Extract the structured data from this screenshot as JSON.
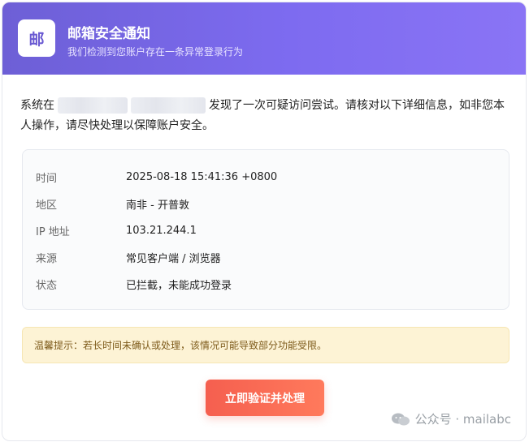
{
  "header": {
    "logo_char": "邮",
    "title": "邮箱安全通知",
    "subtitle": "我们检测到您账户存在一条异常登录行为"
  },
  "message": {
    "prefix": "系统在",
    "suffix": "发现了一次可疑访问尝试。请核对以下详细信息，如非您本人操作，请尽快处理以保障账户安全。"
  },
  "info": {
    "rows": [
      {
        "label": "时间",
        "value": "2025-08-18 15:41:36 +0800"
      },
      {
        "label": "地区",
        "value": "南非 - 开普敦"
      },
      {
        "label": "IP 地址",
        "value": "103.21.244.1"
      },
      {
        "label": "来源",
        "value": "常见客户端 / 浏览器"
      },
      {
        "label": "状态",
        "value": "已拦截，未能成功登录"
      }
    ]
  },
  "tip": {
    "text": "温馨提示：若长时间未确认或处理，该情况可能导致部分功能受限。"
  },
  "action": {
    "button_label": "立即验证并处理"
  },
  "watermark": {
    "text": "公众号 · mailabc",
    "icon": "wechat-icon"
  },
  "colors": {
    "header_start": "#6d5fd6",
    "header_end": "#8a74f5",
    "button": "#f55f4f",
    "tip_bg": "#fdf3d5"
  }
}
